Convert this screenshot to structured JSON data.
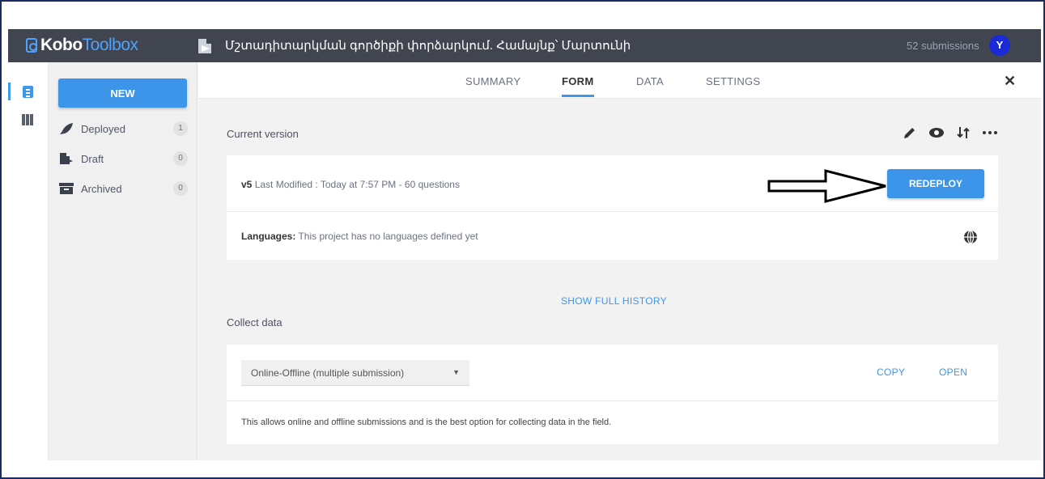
{
  "header": {
    "logo_bold": "Kobo",
    "logo_light": "Toolbox",
    "project_title": "Մշտադիտարկման գործիքի փորձարկում. Համայնք՝ Մարտունի",
    "submissions": "52 submissions",
    "avatar_initial": "Y"
  },
  "sidebar": {
    "new_label": "NEW",
    "items": [
      {
        "label": "Deployed",
        "count": "1",
        "icon": "rocket-icon"
      },
      {
        "label": "Draft",
        "count": "0",
        "icon": "draft-icon"
      },
      {
        "label": "Archived",
        "count": "0",
        "icon": "archive-icon"
      }
    ]
  },
  "tabs": [
    {
      "label": "SUMMARY",
      "active": false
    },
    {
      "label": "FORM",
      "active": true
    },
    {
      "label": "DATA",
      "active": false
    },
    {
      "label": "SETTINGS",
      "active": false
    }
  ],
  "form": {
    "current_version_label": "Current version",
    "version": "v5",
    "last_modified": "Last Modified : Today at 7:57 PM - 60 questions",
    "redeploy_label": "REDEPLOY",
    "languages_label": "Languages:",
    "languages_text": "This project has no languages defined yet",
    "show_history": "SHOW FULL HISTORY"
  },
  "collect": {
    "label": "Collect data",
    "selected_option": "Online-Offline (multiple submission)",
    "copy_label": "COPY",
    "open_label": "OPEN",
    "description": "This allows online and offline submissions and is the best option for collecting data in the field."
  },
  "colors": {
    "accent": "#3d95ea",
    "topbar": "#41454f"
  }
}
